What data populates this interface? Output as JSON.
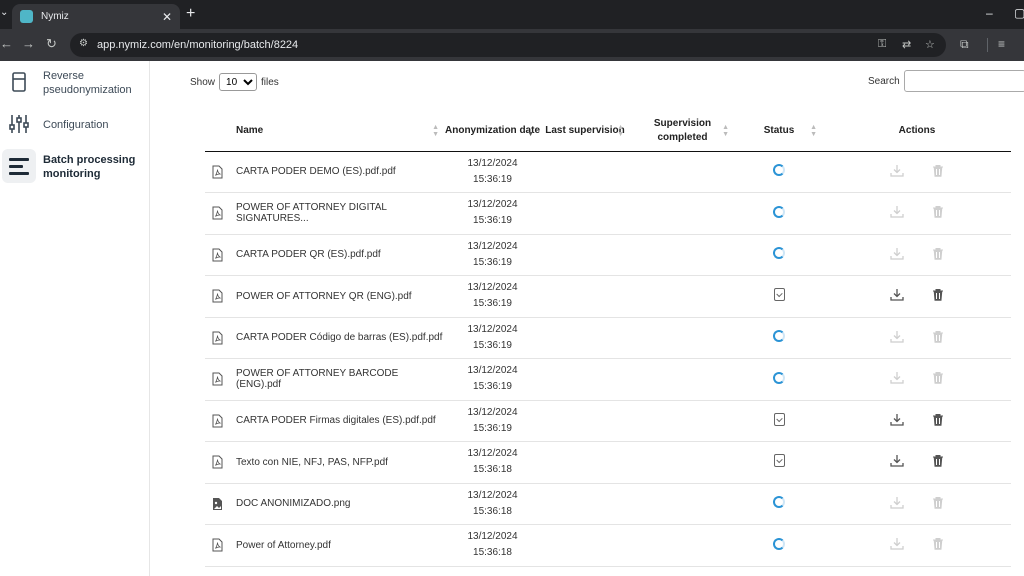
{
  "browser": {
    "tab_title": "Nymiz",
    "tab_close": "✕",
    "new_tab": "+",
    "url": "app.nymiz.com/en/monitoring/batch/8224"
  },
  "sidebar": {
    "items": [
      {
        "label": "Reverse pseudonymization",
        "icon": "document-icon"
      },
      {
        "label": "Configuration",
        "icon": "sliders-icon"
      },
      {
        "label": "Batch processing monitoring",
        "icon": "list-icon",
        "active": true
      }
    ]
  },
  "controls": {
    "show_label": "Show",
    "show_value": "10",
    "files_label": "files",
    "search_label": "Search",
    "search_value": ""
  },
  "table": {
    "headers": {
      "name": "Name",
      "date": "Anonymization date",
      "last_supervision": "Last supervision",
      "supervision_completed": "Supervision completed",
      "status": "Status",
      "actions": "Actions"
    },
    "rows": [
      {
        "name": "CARTA PODER DEMO (ES).pdf.pdf",
        "date": "13/12/2024",
        "time": "15:36:19",
        "status": "processing",
        "file_type": "pdf"
      },
      {
        "name": "POWER OF ATTORNEY DIGITAL SIGNATURES...",
        "date": "13/12/2024",
        "time": "15:36:19",
        "status": "processing",
        "file_type": "pdf"
      },
      {
        "name": "CARTA PODER QR (ES).pdf.pdf",
        "date": "13/12/2024",
        "time": "15:36:19",
        "status": "processing",
        "file_type": "pdf"
      },
      {
        "name": "POWER OF ATTORNEY QR (ENG).pdf",
        "date": "13/12/2024",
        "time": "15:36:19",
        "status": "completed",
        "file_type": "pdf"
      },
      {
        "name": "CARTA PODER Código de barras (ES).pdf.pdf",
        "date": "13/12/2024",
        "time": "15:36:19",
        "status": "processing",
        "file_type": "pdf"
      },
      {
        "name": "POWER OF ATTORNEY BARCODE (ENG).pdf",
        "date": "13/12/2024",
        "time": "15:36:19",
        "status": "processing",
        "file_type": "pdf"
      },
      {
        "name": "CARTA PODER Firmas digitales (ES).pdf.pdf",
        "date": "13/12/2024",
        "time": "15:36:19",
        "status": "completed",
        "file_type": "pdf"
      },
      {
        "name": "Texto con NIE, NFJ, PAS, NFP.pdf",
        "date": "13/12/2024",
        "time": "15:36:18",
        "status": "completed",
        "file_type": "pdf"
      },
      {
        "name": "DOC ANONIMIZADO.png",
        "date": "13/12/2024",
        "time": "15:36:18",
        "status": "processing",
        "file_type": "image"
      },
      {
        "name": "Power of Attorney.pdf",
        "date": "13/12/2024",
        "time": "15:36:18",
        "status": "processing",
        "file_type": "pdf"
      }
    ]
  },
  "colors": {
    "spinner": "#2a93d5",
    "browser_dark": "#202124",
    "browser_toolbar": "#35363a"
  }
}
